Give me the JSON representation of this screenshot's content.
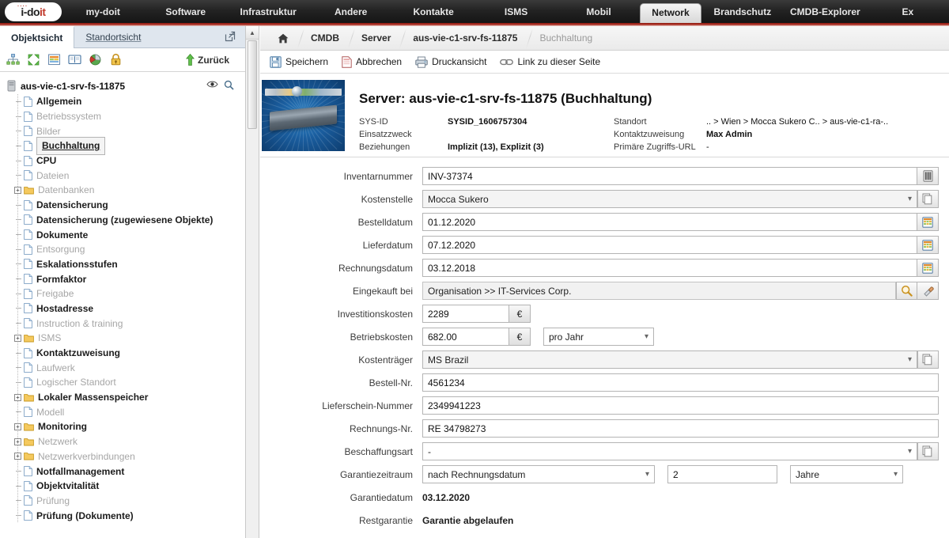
{
  "app": {
    "logo_i": "i-",
    "logo_do": "do",
    "logo_it": "it",
    "logo_dots": "····"
  },
  "topnav": {
    "items": [
      {
        "label": "my-doit",
        "active": false
      },
      {
        "label": "Software",
        "active": false
      },
      {
        "label": "Infrastruktur",
        "active": false
      },
      {
        "label": "Andere",
        "active": false
      },
      {
        "label": "Kontakte",
        "active": false
      },
      {
        "label": "ISMS",
        "active": false
      },
      {
        "label": "Mobil",
        "active": false
      },
      {
        "label": "Network",
        "active": true
      },
      {
        "label": "Brandschutz",
        "active": false
      },
      {
        "label": "CMDB-Explorer",
        "active": false
      },
      {
        "label": "Ex",
        "active": false
      }
    ]
  },
  "leftpanel": {
    "tabs": [
      {
        "label": "Objektsicht",
        "active": true
      },
      {
        "label": "Standortsicht",
        "active": false
      }
    ],
    "popout_icon": "popout-icon",
    "toolbar": {
      "icons": [
        "hierarchy-icon",
        "expand-all-icon",
        "spreadsheet-icon",
        "book-icon",
        "pie-chart-icon",
        "lock-icon"
      ],
      "back_label": "Zurück"
    },
    "root": {
      "label": "aus-vie-c1-srv-fs-11875",
      "eye_icon": "eye-icon",
      "search_icon": "magnifier-icon"
    },
    "tree": [
      {
        "label": "Allgemein",
        "type": "doc",
        "state": "on"
      },
      {
        "label": "Betriebssystem",
        "type": "doc",
        "state": "off"
      },
      {
        "label": "Bilder",
        "type": "doc",
        "state": "off"
      },
      {
        "label": "Buchhaltung",
        "type": "doc",
        "state": "sel"
      },
      {
        "label": "CPU",
        "type": "doc",
        "state": "on"
      },
      {
        "label": "Dateien",
        "type": "doc",
        "state": "off"
      },
      {
        "label": "Datenbanken",
        "type": "folder",
        "state": "off"
      },
      {
        "label": "Datensicherung",
        "type": "doc",
        "state": "on"
      },
      {
        "label": "Datensicherung (zugewiesene Objekte)",
        "type": "doc",
        "state": "on"
      },
      {
        "label": "Dokumente",
        "type": "doc",
        "state": "on"
      },
      {
        "label": "Entsorgung",
        "type": "doc",
        "state": "off"
      },
      {
        "label": "Eskalationsstufen",
        "type": "doc",
        "state": "on"
      },
      {
        "label": "Formfaktor",
        "type": "doc",
        "state": "on"
      },
      {
        "label": "Freigabe",
        "type": "doc",
        "state": "off"
      },
      {
        "label": "Hostadresse",
        "type": "doc",
        "state": "on"
      },
      {
        "label": "Instruction & training",
        "type": "doc",
        "state": "off"
      },
      {
        "label": "ISMS",
        "type": "folder",
        "state": "off"
      },
      {
        "label": "Kontaktzuweisung",
        "type": "doc",
        "state": "on"
      },
      {
        "label": "Laufwerk",
        "type": "doc",
        "state": "off"
      },
      {
        "label": "Logischer Standort",
        "type": "doc",
        "state": "off"
      },
      {
        "label": "Lokaler Massenspeicher",
        "type": "folder",
        "state": "on"
      },
      {
        "label": "Modell",
        "type": "doc",
        "state": "off"
      },
      {
        "label": "Monitoring",
        "type": "folder",
        "state": "on"
      },
      {
        "label": "Netzwerk",
        "type": "folder",
        "state": "off"
      },
      {
        "label": "Netzwerkverbindungen",
        "type": "folder",
        "state": "off"
      },
      {
        "label": "Notfallmanagement",
        "type": "doc",
        "state": "on"
      },
      {
        "label": "Objektvitalität",
        "type": "doc",
        "state": "on"
      },
      {
        "label": "Prüfung",
        "type": "doc",
        "state": "off"
      },
      {
        "label": "Prüfung (Dokumente)",
        "type": "doc",
        "state": "on"
      }
    ]
  },
  "breadcrumb": {
    "home_icon": "home-icon",
    "items": [
      {
        "label": "CMDB",
        "current": false
      },
      {
        "label": "Server",
        "current": false
      },
      {
        "label": "aus-vie-c1-srv-fs-11875",
        "current": false
      },
      {
        "label": "Buchhaltung",
        "current": true
      }
    ]
  },
  "actions": [
    {
      "label": "Speichern",
      "icon": "save-icon"
    },
    {
      "label": "Abbrechen",
      "icon": "cancel-icon"
    },
    {
      "label": "Druckansicht",
      "icon": "print-icon"
    },
    {
      "label": "Link zu dieser Seite",
      "icon": "link-icon"
    }
  ],
  "object_header": {
    "image_alt": "server-thumbnail",
    "title": "Server: aus-vie-c1-srv-fs-11875 (Buchhaltung)",
    "left": [
      {
        "label": "SYS-ID",
        "value": "SYSID_1606757304"
      },
      {
        "label": "Einsatzzweck",
        "value": ""
      },
      {
        "label": "Beziehungen",
        "value": "Implizit (13), Explizit (3)"
      }
    ],
    "right": [
      {
        "label": "Standort",
        "value": ".. > Wien > Mocca Sukero C.. > aus-vie-c1-ra-.."
      },
      {
        "label": "Kontaktzuweisung",
        "value": "Max Admin"
      },
      {
        "label": "Primäre Zugriffs-URL",
        "value": "-"
      }
    ]
  },
  "form": {
    "inventarnummer": {
      "label": "Inventarnummer",
      "value": "INV-37374",
      "button_icon": "barcode-icon"
    },
    "kostenstelle": {
      "label": "Kostenstelle",
      "value": "Mocca Sukero",
      "button_icon": "copy-icon"
    },
    "bestelldatum": {
      "label": "Bestelldatum",
      "value": "01.12.2020",
      "button_icon": "calendar-icon"
    },
    "lieferdatum": {
      "label": "Lieferdatum",
      "value": "07.12.2020",
      "button_icon": "calendar-icon"
    },
    "rechnungsdatum": {
      "label": "Rechnungsdatum",
      "value": "03.12.2018",
      "button_icon": "calendar-icon"
    },
    "eingekauft_bei": {
      "label": "Eingekauft bei",
      "value": "Organisation >> IT-Services Corp.",
      "button_icon": "magnifier-icon",
      "button_icon2": "unlink-icon"
    },
    "investitionskosten": {
      "label": "Investitionskosten",
      "value": "2289",
      "currency": "€"
    },
    "betriebskosten": {
      "label": "Betriebskosten",
      "value": "682.00",
      "currency": "€",
      "interval": "pro Jahr"
    },
    "kostentraeger": {
      "label": "Kostenträger",
      "value": "MS Brazil",
      "button_icon": "copy-icon"
    },
    "bestell_nr": {
      "label": "Bestell-Nr.",
      "value": "4561234"
    },
    "lieferschein_nummer": {
      "label": "Lieferschein-Nummer",
      "value": "2349941223"
    },
    "rechnungs_nr": {
      "label": "Rechnungs-Nr.",
      "value": "RE 34798273"
    },
    "beschaffungsart": {
      "label": "Beschaffungsart",
      "value": "-",
      "button_icon": "copy-icon"
    },
    "garantiezeitraum": {
      "label": "Garantiezeitraum",
      "value": "nach Rechnungsdatum",
      "amount": "2",
      "unit": "Jahre"
    },
    "garantiedatum": {
      "label": "Garantiedatum",
      "value": "03.12.2020"
    },
    "restgarantie": {
      "label": "Restgarantie",
      "value": "Garantie abgelaufen"
    }
  },
  "colors": {
    "brand_red": "#8d1b12",
    "nav_dark": "#232323",
    "tab_blue": "#dfe6ee",
    "accent_text": "#c0392b"
  }
}
